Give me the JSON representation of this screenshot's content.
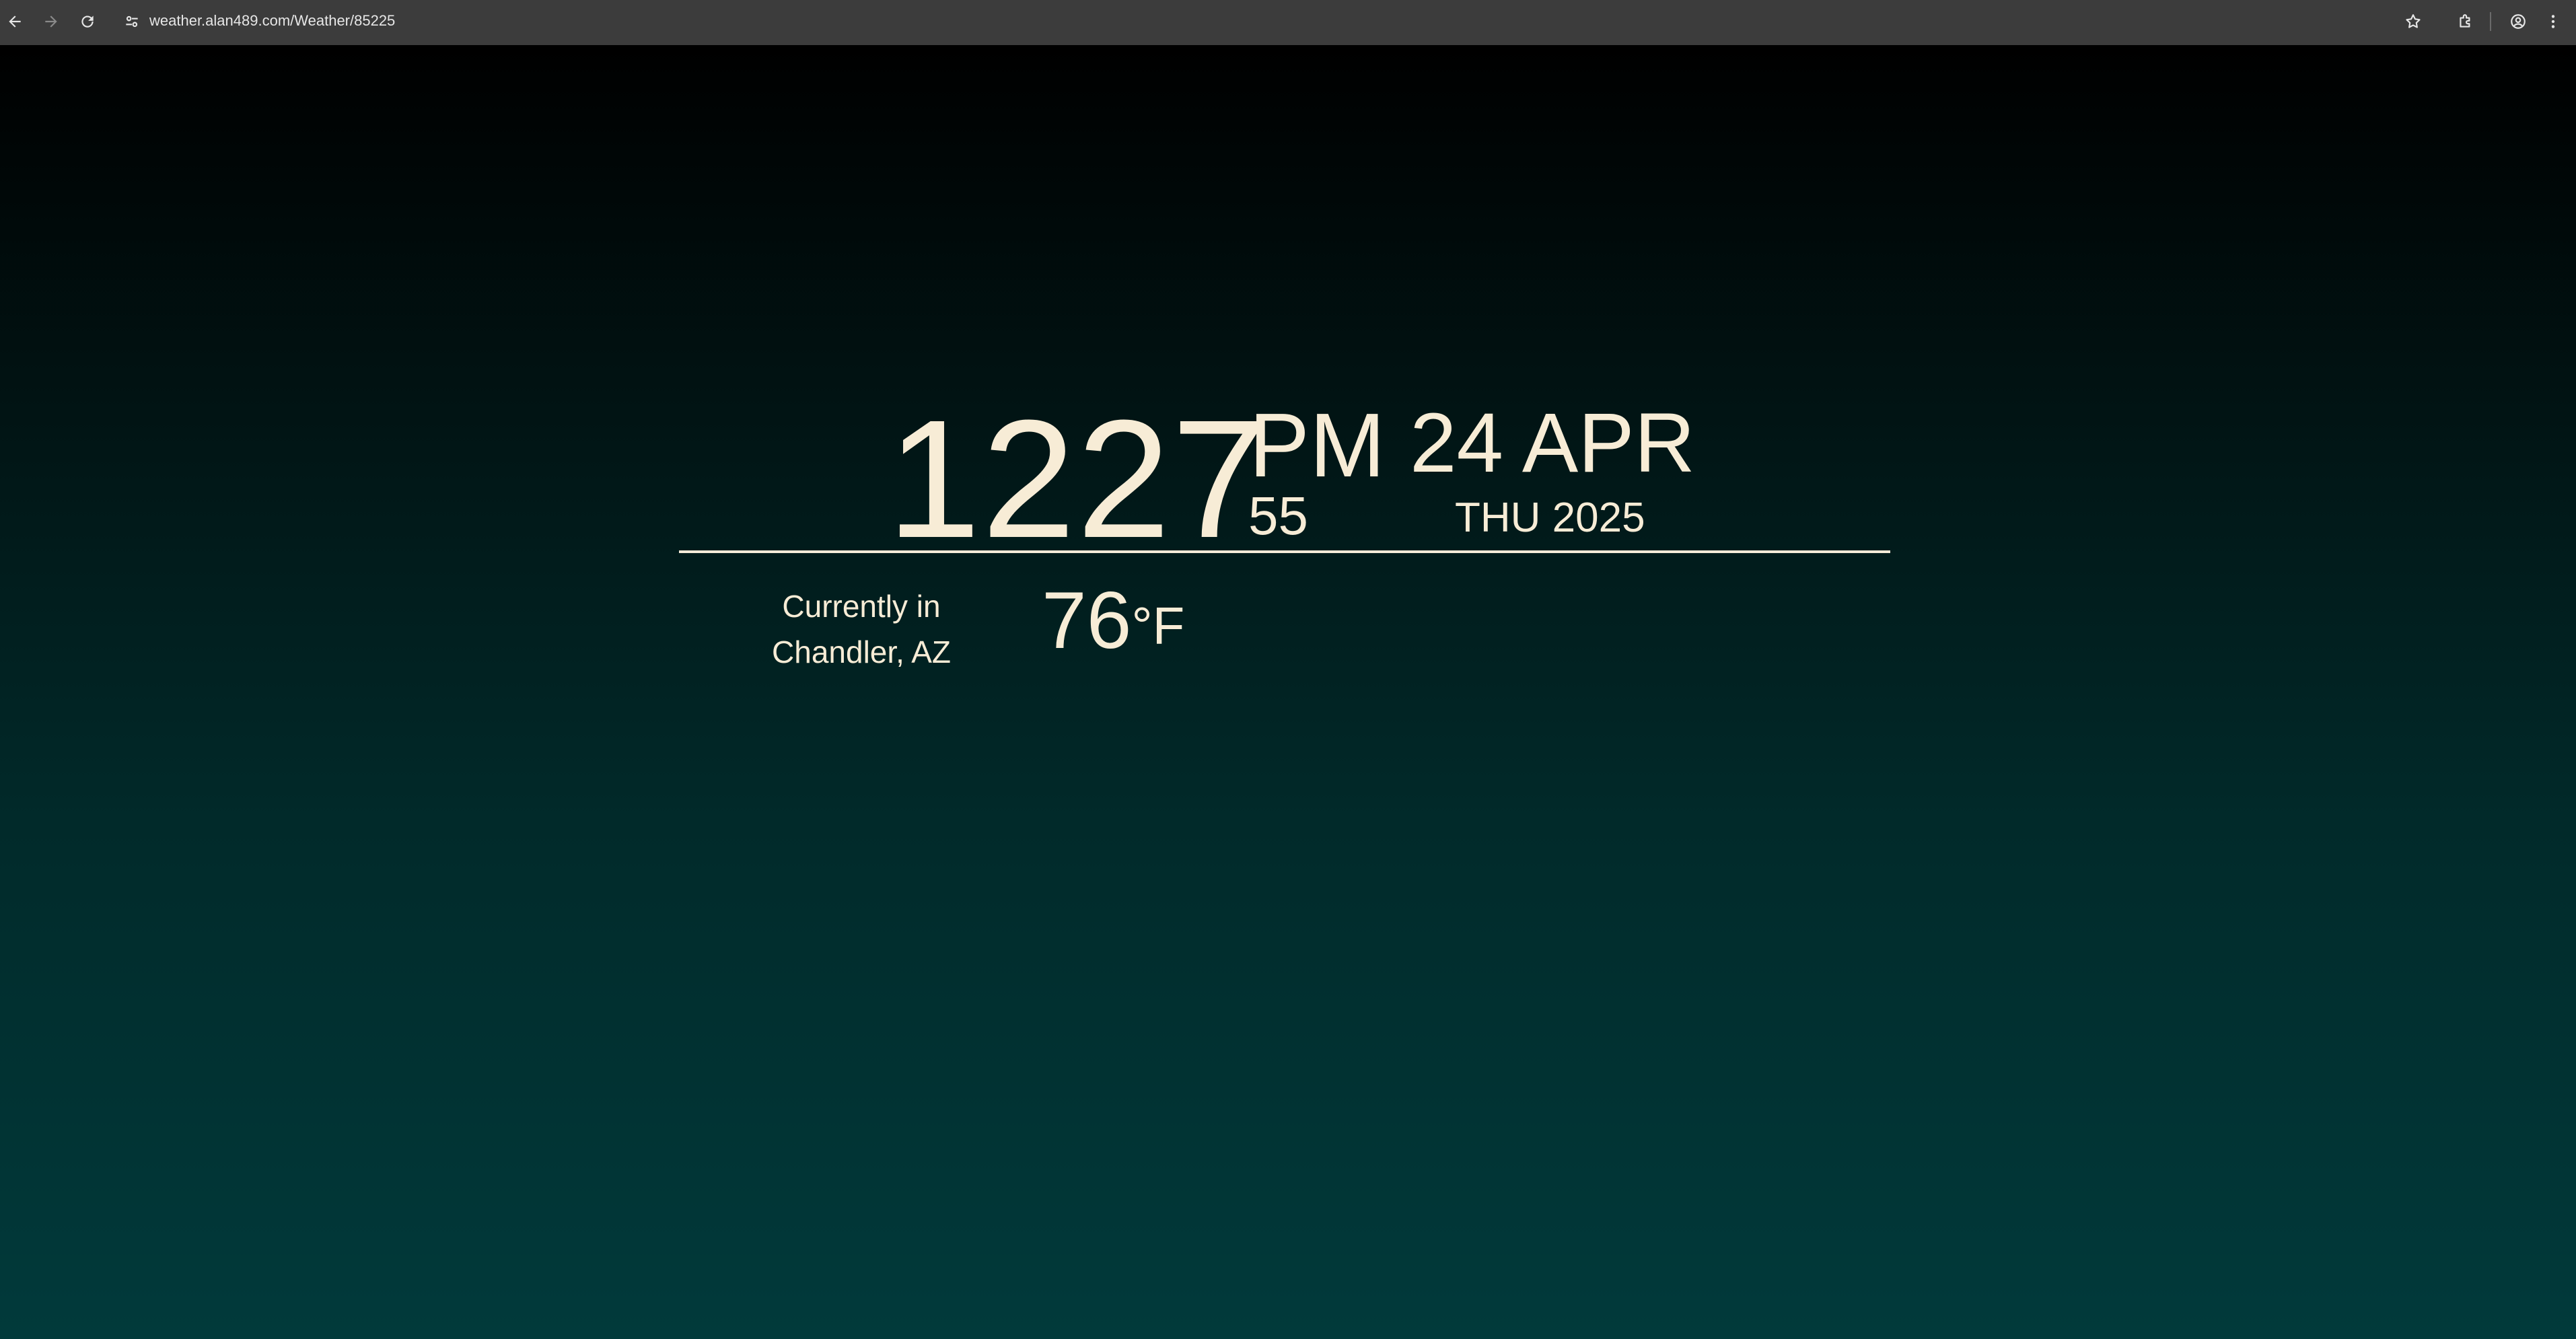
{
  "browser": {
    "url": "weather.alan489.com/Weather/85225",
    "icons": {
      "back": "back-arrow-icon",
      "forward": "forward-arrow-icon",
      "reload": "reload-icon",
      "site_info": "site-settings-icon",
      "bookmark": "star-icon",
      "extensions": "puzzle-icon",
      "profile": "profile-icon",
      "menu": "kebab-menu-icon"
    }
  },
  "clock": {
    "hour_minute": "1227",
    "ampm": "PM",
    "seconds": "55"
  },
  "date": {
    "day_month": "24 APR",
    "weekday_year": "THU 2025"
  },
  "weather": {
    "location_line1": "Currently in",
    "location_line2": "Chandler, AZ",
    "temperature": "76",
    "unit": "°F"
  },
  "colors": {
    "text": "#f7ecd6",
    "chrome": "#3c3c3c",
    "gradient_top": "#000000",
    "gradient_bottom": "#013a3b"
  }
}
